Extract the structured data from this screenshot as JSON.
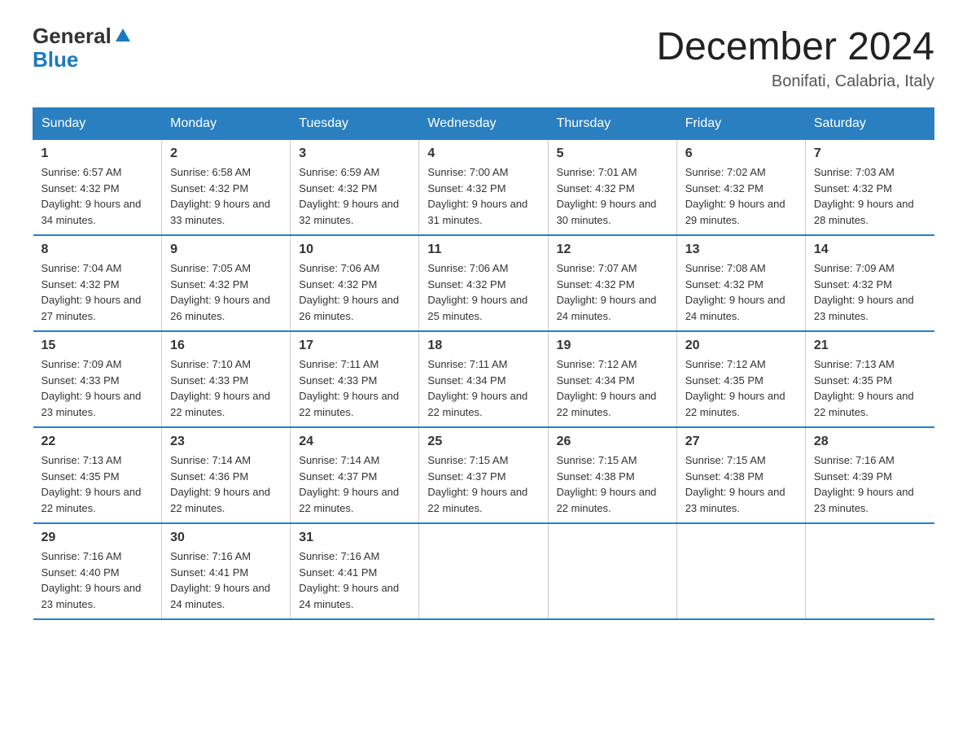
{
  "header": {
    "logo_general": "General",
    "logo_blue": "Blue",
    "title": "December 2024",
    "location": "Bonifati, Calabria, Italy"
  },
  "days_of_week": [
    "Sunday",
    "Monday",
    "Tuesday",
    "Wednesday",
    "Thursday",
    "Friday",
    "Saturday"
  ],
  "weeks": [
    [
      {
        "day": "1",
        "sunrise": "6:57 AM",
        "sunset": "4:32 PM",
        "daylight": "9 hours and 34 minutes."
      },
      {
        "day": "2",
        "sunrise": "6:58 AM",
        "sunset": "4:32 PM",
        "daylight": "9 hours and 33 minutes."
      },
      {
        "day": "3",
        "sunrise": "6:59 AM",
        "sunset": "4:32 PM",
        "daylight": "9 hours and 32 minutes."
      },
      {
        "day": "4",
        "sunrise": "7:00 AM",
        "sunset": "4:32 PM",
        "daylight": "9 hours and 31 minutes."
      },
      {
        "day": "5",
        "sunrise": "7:01 AM",
        "sunset": "4:32 PM",
        "daylight": "9 hours and 30 minutes."
      },
      {
        "day": "6",
        "sunrise": "7:02 AM",
        "sunset": "4:32 PM",
        "daylight": "9 hours and 29 minutes."
      },
      {
        "day": "7",
        "sunrise": "7:03 AM",
        "sunset": "4:32 PM",
        "daylight": "9 hours and 28 minutes."
      }
    ],
    [
      {
        "day": "8",
        "sunrise": "7:04 AM",
        "sunset": "4:32 PM",
        "daylight": "9 hours and 27 minutes."
      },
      {
        "day": "9",
        "sunrise": "7:05 AM",
        "sunset": "4:32 PM",
        "daylight": "9 hours and 26 minutes."
      },
      {
        "day": "10",
        "sunrise": "7:06 AM",
        "sunset": "4:32 PM",
        "daylight": "9 hours and 26 minutes."
      },
      {
        "day": "11",
        "sunrise": "7:06 AM",
        "sunset": "4:32 PM",
        "daylight": "9 hours and 25 minutes."
      },
      {
        "day": "12",
        "sunrise": "7:07 AM",
        "sunset": "4:32 PM",
        "daylight": "9 hours and 24 minutes."
      },
      {
        "day": "13",
        "sunrise": "7:08 AM",
        "sunset": "4:32 PM",
        "daylight": "9 hours and 24 minutes."
      },
      {
        "day": "14",
        "sunrise": "7:09 AM",
        "sunset": "4:32 PM",
        "daylight": "9 hours and 23 minutes."
      }
    ],
    [
      {
        "day": "15",
        "sunrise": "7:09 AM",
        "sunset": "4:33 PM",
        "daylight": "9 hours and 23 minutes."
      },
      {
        "day": "16",
        "sunrise": "7:10 AM",
        "sunset": "4:33 PM",
        "daylight": "9 hours and 22 minutes."
      },
      {
        "day": "17",
        "sunrise": "7:11 AM",
        "sunset": "4:33 PM",
        "daylight": "9 hours and 22 minutes."
      },
      {
        "day": "18",
        "sunrise": "7:11 AM",
        "sunset": "4:34 PM",
        "daylight": "9 hours and 22 minutes."
      },
      {
        "day": "19",
        "sunrise": "7:12 AM",
        "sunset": "4:34 PM",
        "daylight": "9 hours and 22 minutes."
      },
      {
        "day": "20",
        "sunrise": "7:12 AM",
        "sunset": "4:35 PM",
        "daylight": "9 hours and 22 minutes."
      },
      {
        "day": "21",
        "sunrise": "7:13 AM",
        "sunset": "4:35 PM",
        "daylight": "9 hours and 22 minutes."
      }
    ],
    [
      {
        "day": "22",
        "sunrise": "7:13 AM",
        "sunset": "4:35 PM",
        "daylight": "9 hours and 22 minutes."
      },
      {
        "day": "23",
        "sunrise": "7:14 AM",
        "sunset": "4:36 PM",
        "daylight": "9 hours and 22 minutes."
      },
      {
        "day": "24",
        "sunrise": "7:14 AM",
        "sunset": "4:37 PM",
        "daylight": "9 hours and 22 minutes."
      },
      {
        "day": "25",
        "sunrise": "7:15 AM",
        "sunset": "4:37 PM",
        "daylight": "9 hours and 22 minutes."
      },
      {
        "day": "26",
        "sunrise": "7:15 AM",
        "sunset": "4:38 PM",
        "daylight": "9 hours and 22 minutes."
      },
      {
        "day": "27",
        "sunrise": "7:15 AM",
        "sunset": "4:38 PM",
        "daylight": "9 hours and 23 minutes."
      },
      {
        "day": "28",
        "sunrise": "7:16 AM",
        "sunset": "4:39 PM",
        "daylight": "9 hours and 23 minutes."
      }
    ],
    [
      {
        "day": "29",
        "sunrise": "7:16 AM",
        "sunset": "4:40 PM",
        "daylight": "9 hours and 23 minutes."
      },
      {
        "day": "30",
        "sunrise": "7:16 AM",
        "sunset": "4:41 PM",
        "daylight": "9 hours and 24 minutes."
      },
      {
        "day": "31",
        "sunrise": "7:16 AM",
        "sunset": "4:41 PM",
        "daylight": "9 hours and 24 minutes."
      },
      null,
      null,
      null,
      null
    ]
  ],
  "labels": {
    "sunrise": "Sunrise:",
    "sunset": "Sunset:",
    "daylight": "Daylight:"
  }
}
